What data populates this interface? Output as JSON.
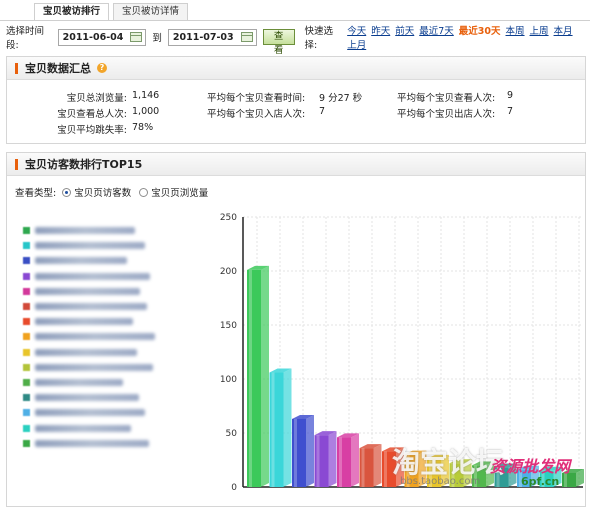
{
  "tabs": [
    "宝贝被访排行",
    "宝贝被访详情"
  ],
  "datebar": {
    "label": "选择时间段:",
    "start": "2011-06-04",
    "to": "到",
    "end": "2011-07-03",
    "query": "查看",
    "quick_label": "快速选择:",
    "quick": [
      "今天",
      "昨天",
      "前天",
      "最近7天",
      "最近30天",
      "本周",
      "上周",
      "本月",
      "上月"
    ],
    "quick_active": "最近30天"
  },
  "summary": {
    "title": "宝贝数据汇总",
    "items": [
      {
        "label": "宝贝总浏览量:",
        "value": "1,146"
      },
      {
        "label": "宝贝查看总人次:",
        "value": "1,000"
      },
      {
        "label": "宝贝平均跳失率:",
        "value": "78%"
      },
      {
        "label": "平均每个宝贝查看时间:",
        "value": "9 分27 秒"
      },
      {
        "label": "平均每个宝贝入店人次:",
        "value": "7"
      },
      {
        "label": "平均每个宝贝查看人次:",
        "value": "9"
      },
      {
        "label": "平均每个宝贝出店人次:",
        "value": "7"
      }
    ]
  },
  "rank": {
    "title": "宝贝访客数排行TOP15",
    "view_label": "查看类型:",
    "options": [
      "宝贝页访客数",
      "宝贝页浏览量"
    ],
    "selected": "宝贝页访客数"
  },
  "legend_colors": [
    "#2fa84f",
    "#27c6c9",
    "#3a4fc4",
    "#8a49d3",
    "#d3399b",
    "#d24a3a",
    "#e84b2c",
    "#f0a21f",
    "#e8c52a",
    "#b3c43a",
    "#4fae48",
    "#2f8a85",
    "#4fb0e6",
    "#2bd0c0",
    "#3aa845"
  ],
  "watermark": {
    "left": "淘宝论坛",
    "url": "bbs.taobao.com",
    "right": "资源批发网",
    "site": "6pf.cn"
  },
  "chart_data": {
    "type": "bar",
    "ylim": [
      0,
      250
    ],
    "yticks": [
      "0",
      "50",
      "100",
      "150",
      "200",
      "250"
    ],
    "values": [
      201,
      106,
      63,
      48,
      46,
      36,
      33,
      30,
      26,
      22,
      20,
      18,
      16,
      15,
      13
    ],
    "colors": [
      "#3cc95a",
      "#3bd6d9",
      "#3f4fcf",
      "#8a49d3",
      "#d83fa4",
      "#d9553e",
      "#e84b2c",
      "#f0a21f",
      "#e8c52a",
      "#b8cc38",
      "#52b84d",
      "#2f9c95",
      "#4fb0e6",
      "#2bd0c0",
      "#3aa845"
    ]
  }
}
